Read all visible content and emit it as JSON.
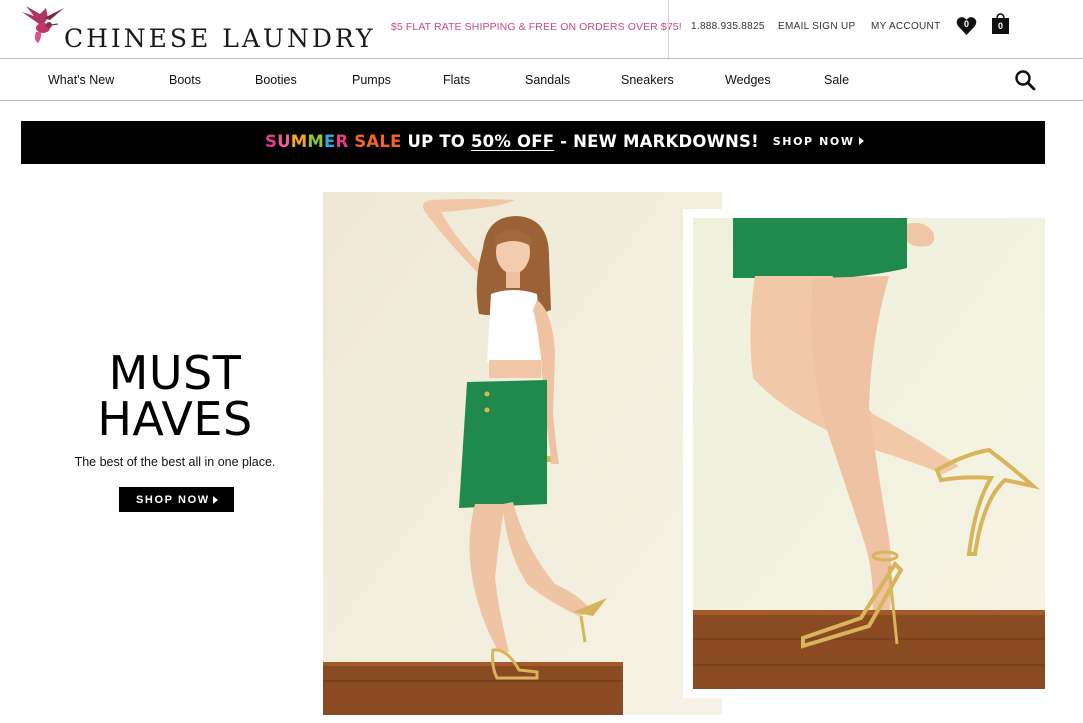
{
  "brand": {
    "name": "CHINESE LAUNDRY",
    "logo_icon": "hummingbird-logo",
    "accent_color": "#c74a8a"
  },
  "header": {
    "promo": "$5 FLAT RATE SHIPPING & FREE ON ORDERS OVER $75!",
    "phone": "1.888.935.8825",
    "email_signup": "EMAIL SIGN UP",
    "my_account": "MY ACCOUNT",
    "wishlist_count": "0",
    "cart_count": "0"
  },
  "nav": {
    "items": [
      {
        "label": "What's New"
      },
      {
        "label": "Boots"
      },
      {
        "label": "Booties"
      },
      {
        "label": "Pumps"
      },
      {
        "label": "Flats"
      },
      {
        "label": "Sandals"
      },
      {
        "label": "Sneakers"
      },
      {
        "label": "Wedges"
      },
      {
        "label": "Sale"
      }
    ],
    "search_icon": "search-icon"
  },
  "banner": {
    "summer_letters": [
      "S",
      "U",
      "M",
      "M",
      "E",
      "R"
    ],
    "summer_colors": [
      "#e63a8f",
      "#f25a9b",
      "#f5a623",
      "#8cc63f",
      "#29abe2",
      "#e63a8f"
    ],
    "sale_word": "SALE",
    "sale_color": "#f26522",
    "upto": "UP TO",
    "pct": "50% OFF",
    "rest": "- NEW MARKDOWNS!",
    "shop_now": "SHOP NOW"
  },
  "hero": {
    "title_line1": "MUST",
    "title_line2": "HAVES",
    "subtitle": "The best of the best all in one place.",
    "shop_now": "SHOP NOW"
  },
  "colors": {
    "skirt": "#1f8a4c",
    "sandal": "#d8b45a",
    "wood": "#8a4a22"
  }
}
